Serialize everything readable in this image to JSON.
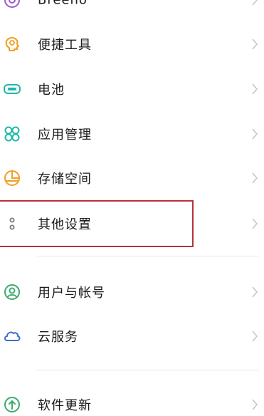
{
  "settings_list": {
    "items": [
      {
        "label": "Breeno",
        "icon": "breeno-icon"
      },
      {
        "label": "便捷工具",
        "icon": "convenient-tools-icon"
      },
      {
        "label": "电池",
        "icon": "battery-icon"
      },
      {
        "label": "应用管理",
        "icon": "app-management-icon"
      },
      {
        "label": "存储空间",
        "icon": "storage-icon"
      },
      {
        "label": "其他设置",
        "icon": "other-settings-icon"
      },
      {
        "label": "用户与帐号",
        "icon": "users-accounts-icon"
      },
      {
        "label": "云服务",
        "icon": "cloud-service-icon"
      },
      {
        "label": "软件更新",
        "icon": "software-update-icon"
      }
    ]
  },
  "colors": {
    "highlight_border": "#b5333d",
    "breeno": "#9b59d0",
    "tools": "#f0a020",
    "battery": "#1fb8a8",
    "apps": "#1fb8a8",
    "storage": "#f0a020",
    "other": "#7a7a7a",
    "users": "#3daa6a",
    "cloud": "#3b6fd0",
    "update": "#3daa6a"
  }
}
